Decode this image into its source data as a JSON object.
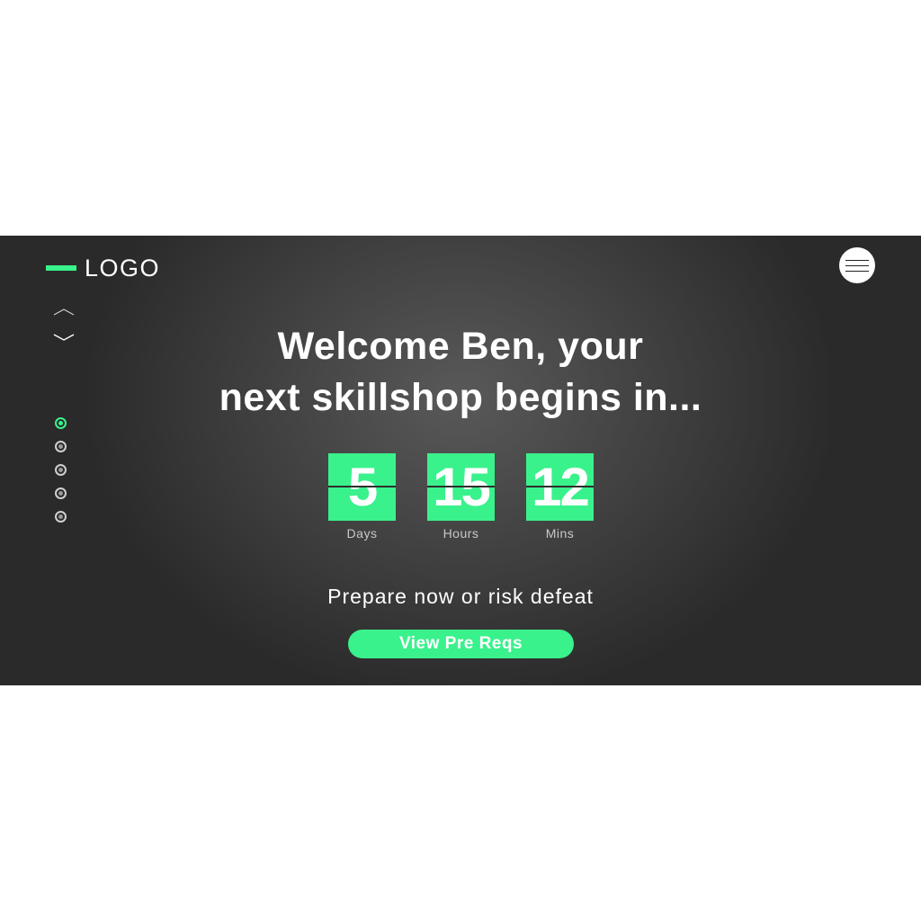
{
  "colors": {
    "accent": "#39f28b",
    "background": "#3a3a3a",
    "page": "#ffffff"
  },
  "header": {
    "logo_text": "LOGO",
    "menu_icon": "hamburger-menu-icon"
  },
  "side_nav": {
    "up_icon": "chevron-up-icon",
    "down_icon": "chevron-down-icon",
    "dots": [
      {
        "active": true
      },
      {
        "active": false
      },
      {
        "active": false
      },
      {
        "active": false
      },
      {
        "active": false
      }
    ]
  },
  "hero": {
    "headline_line1": "Welcome Ben, your",
    "headline_line2": "next skillshop begins in...",
    "countdown": [
      {
        "value": "5",
        "label": "Days"
      },
      {
        "value": "15",
        "label": "Hours"
      },
      {
        "value": "12",
        "label": "Mins"
      }
    ],
    "tagline": "Prepare now or risk defeat",
    "cta_label": "View Pre Reqs"
  }
}
